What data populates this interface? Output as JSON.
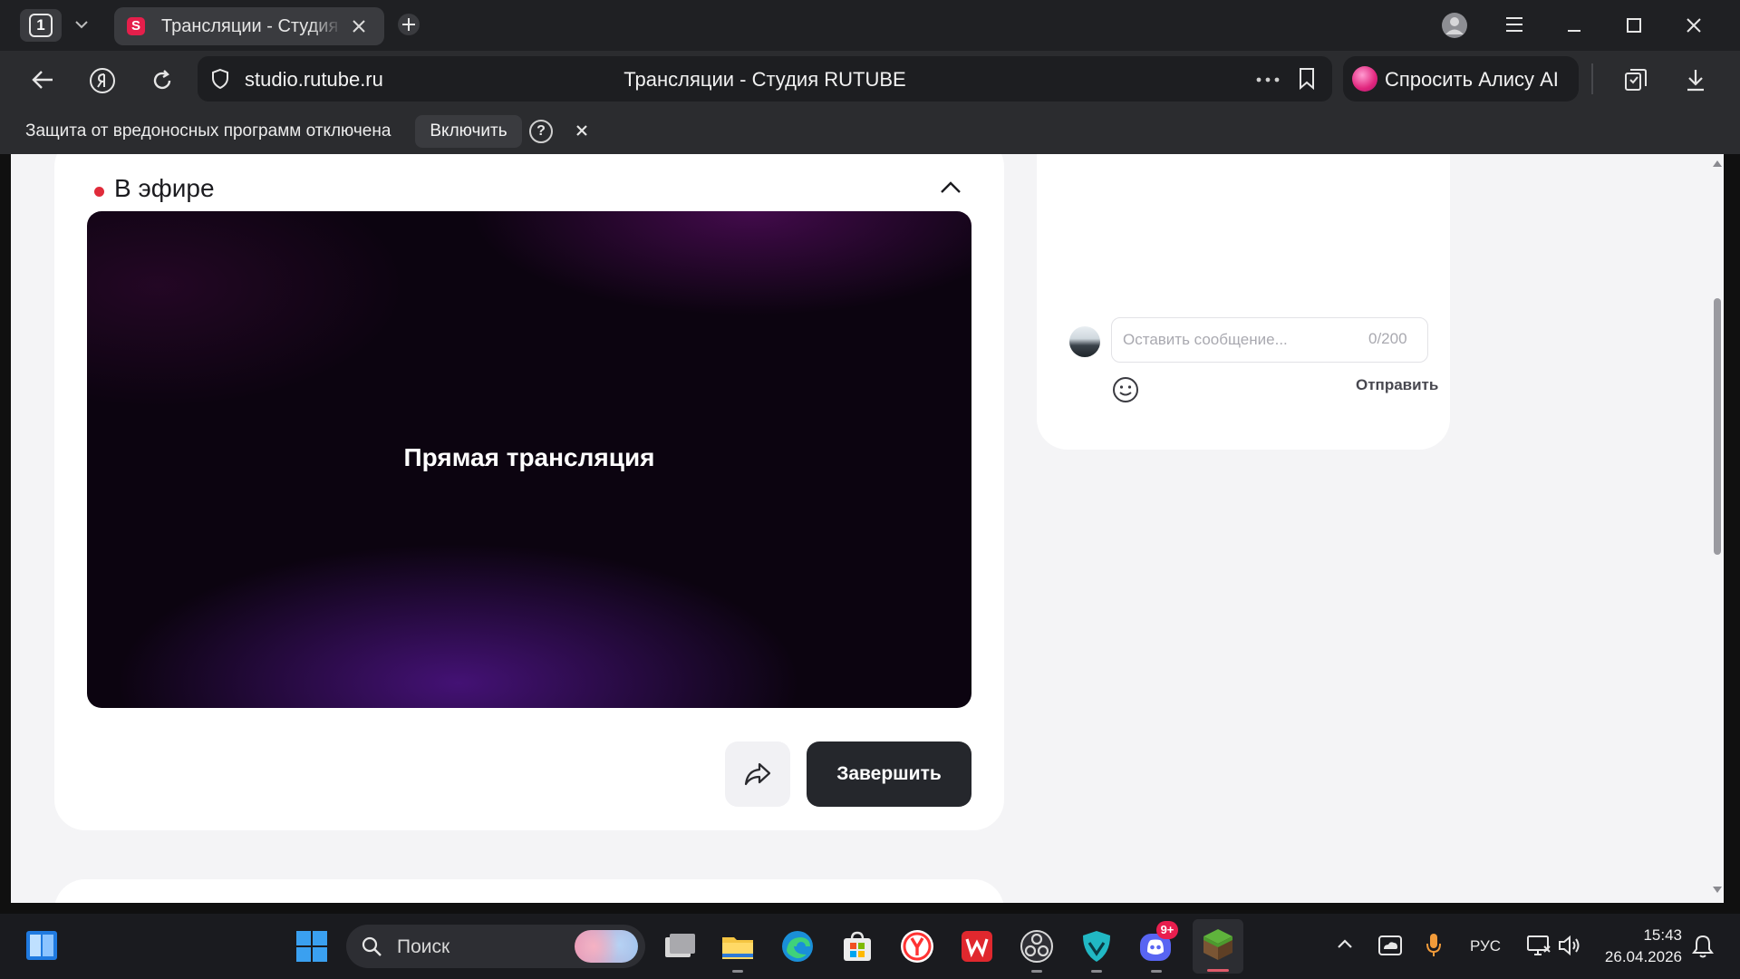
{
  "browser": {
    "tab_count": "1",
    "active_tab": {
      "title": "Трансляции - Студия RUTUBE",
      "favicon_letter": "S"
    },
    "address": {
      "url": "studio.rutube.ru",
      "page_title": "Трансляции - Студия RUTUBE"
    },
    "alice_label": "Спросить Алису AI",
    "infobar": {
      "message": "Защита от вредоносных программ отключена",
      "enable_label": "Включить",
      "help_symbol": "?"
    }
  },
  "page": {
    "live_section_title": "В эфире",
    "player_text": "Прямая трансляция",
    "end_button_label": "Завершить",
    "chat": {
      "input_placeholder": "Оставить сообщение...",
      "char_counter": "0/200",
      "send_label": "Отправить"
    },
    "scrollbar": {
      "position_fraction": 0.28,
      "visible_fraction": 0.36
    }
  },
  "taskbar": {
    "search_placeholder": "Поиск",
    "discord_badge": "9+",
    "language": "РУС",
    "time": "15:43",
    "date": "26.04.2026"
  },
  "colors": {
    "live_dot": "#e02b3a",
    "rutube_brand": "#e51f4b",
    "end_button_bg": "#25272c",
    "page_bg": "#f4f4f6"
  }
}
